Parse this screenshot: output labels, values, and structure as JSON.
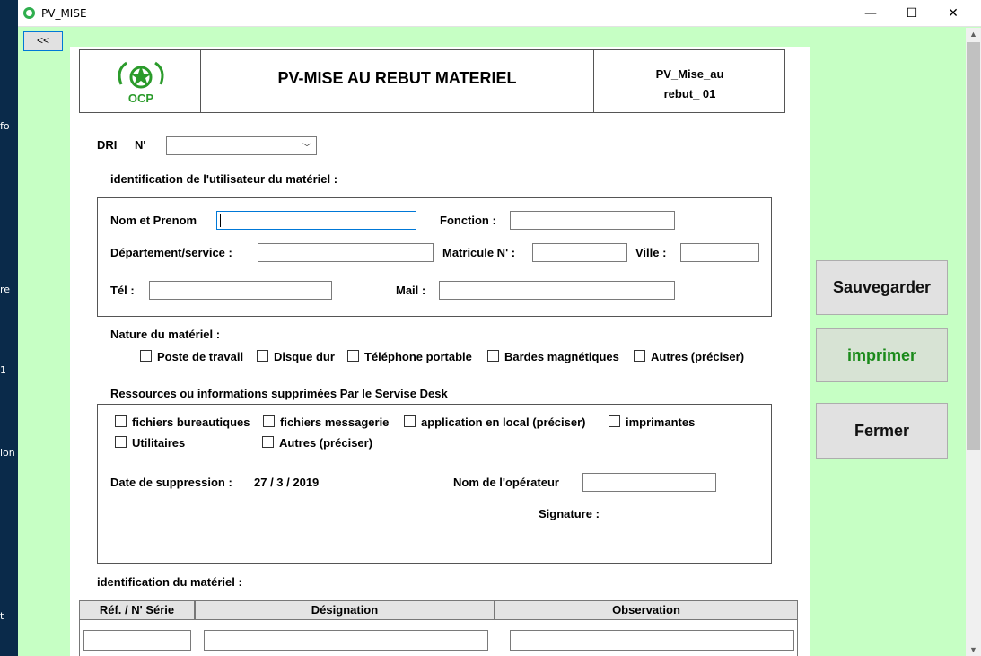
{
  "window": {
    "title": "PV_MISE",
    "minimize": "—",
    "maximize": "☐",
    "close": "✕"
  },
  "desktop": {
    "texts": [
      "fo",
      "re",
      "1",
      "ion",
      "t"
    ]
  },
  "nav": {
    "back_label": "<<"
  },
  "header": {
    "logo_text": "OCP",
    "title": "PV-MISE AU REBUT MATERIEL",
    "ref_line1": "PV_Mise_au",
    "ref_line2": "rebut_ 01"
  },
  "dri": {
    "label": "DRI",
    "number_label": "N'",
    "value": ""
  },
  "user_section": {
    "title": "identification de l'utilisateur du matériel :",
    "nom_label": "Nom et Prenom",
    "fonction_label": "Fonction :",
    "departement_label": "Département/service :",
    "matricule_label": "Matricule N' :",
    "ville_label": "Ville :",
    "tel_label": "Tél :",
    "mail_label": "Mail :"
  },
  "nature_section": {
    "title": "Nature du matériel :",
    "options": [
      "Poste de travail",
      "Disque dur",
      "Téléphone portable",
      "Bardes magnétiques",
      "Autres (préciser)"
    ]
  },
  "resources_section": {
    "title": "Ressources ou informations supprimées Par le Servise Desk",
    "options": [
      "fichiers bureautiques",
      "fichiers messagerie",
      "application en local (préciser)",
      "imprimantes",
      "Utilitaires",
      "Autres (préciser)"
    ],
    "date_label": "Date de suppression :",
    "date_value": "27 / 3 / 2019",
    "operator_label": "Nom de l'opérateur",
    "signature_label": "Signature :"
  },
  "material_section": {
    "title": "identification du matériel :",
    "columns": [
      "Réf. / N' Série",
      "Désignation",
      "Observation"
    ]
  },
  "actions": {
    "save": "Sauvegarder",
    "print": "imprimer",
    "close": "Fermer"
  },
  "colors": {
    "background": "#c6ffc4",
    "print_text": "#1a8a1a",
    "accent": "#0078d7"
  },
  "icons": {
    "app": "app-icon",
    "logo": "ocp-logo-icon",
    "dropdown": "chevron-down-icon"
  }
}
